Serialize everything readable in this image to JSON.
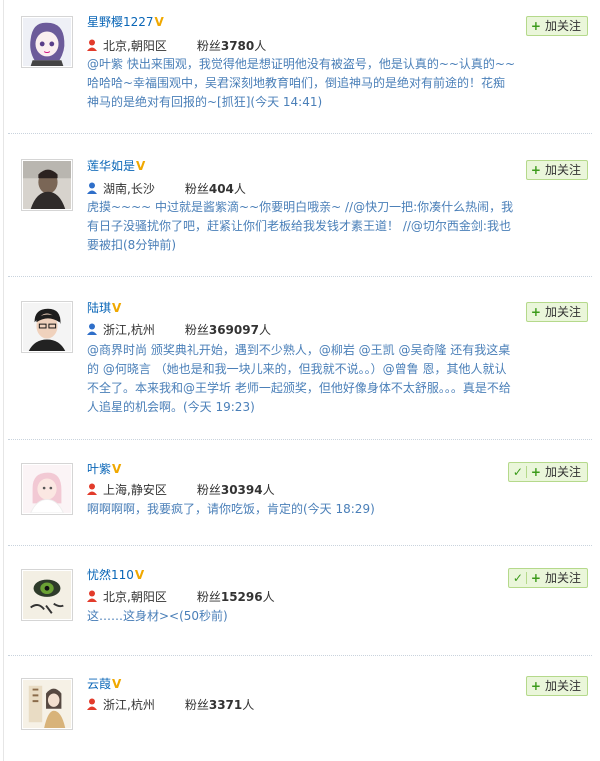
{
  "follow_label": "加关注",
  "users": [
    {
      "name": "星野樱1227",
      "location": "北京,朝阳区",
      "fans_label": "粉丝",
      "fans_count": "3780",
      "fans_unit": "人",
      "gender_icon": "female-user-icon",
      "mutual": false,
      "description": "@叶紫 快出来围观，我觉得他是想证明他没有被盗号，他是认真的~~认真的~~哈哈哈~幸福围观中，吴君深刻地教育咱们，倒追神马的是绝对有前途的！花痴神马的是绝对有回报的~[抓狂](今天 14:41)"
    },
    {
      "name": "莲华如是",
      "location": "湖南,长沙",
      "fans_label": "粉丝",
      "fans_count": "404",
      "fans_unit": "人",
      "gender_icon": "male-user-icon",
      "mutual": false,
      "description": "虎摸~~~~ 中过就是酱紫滴~~你要明白哦亲~ //@快刀一把:你凑什么热闹，我有日子没骚扰你了吧，赶紧让你们老板给我发钱才素王道！ //@切尔西金剑:我也要被扣(8分钟前)"
    },
    {
      "name": "陆琪",
      "location": "浙江,杭州",
      "fans_label": "粉丝",
      "fans_count": "369097",
      "fans_unit": "人",
      "gender_icon": "male-user-icon",
      "mutual": false,
      "description": "@商界时尚 颁奖典礼开始，遇到不少熟人，@柳岩 @王凯 @吴奇隆 还有我这桌的 @何晓言 （她也是和我一块儿来的，但我就不说。。）@曾鲁 恩，其他人就认不全了。本来我和@王学圻 老师一起颁奖，但他好像身体不太舒服。。。真是不给人追星的机会啊。(今天 19:23)"
    },
    {
      "name": "叶紫",
      "location": "上海,静安区",
      "fans_label": "粉丝",
      "fans_count": "30394",
      "fans_unit": "人",
      "gender_icon": "female-user-icon",
      "mutual": true,
      "description": "啊啊啊啊，我要疯了，请你吃饭，肯定的(今天 18:29)"
    },
    {
      "name": "忧然110",
      "location": "北京,朝阳区",
      "fans_label": "粉丝",
      "fans_count": "15296",
      "fans_unit": "人",
      "gender_icon": "female-user-icon",
      "mutual": true,
      "description": "这……这身材><(50秒前)"
    },
    {
      "name": "云葭",
      "location": "浙江,杭州",
      "fans_label": "粉丝",
      "fans_count": "3371",
      "fans_unit": "人",
      "gender_icon": "female-user-icon",
      "mutual": false,
      "description": ""
    }
  ]
}
